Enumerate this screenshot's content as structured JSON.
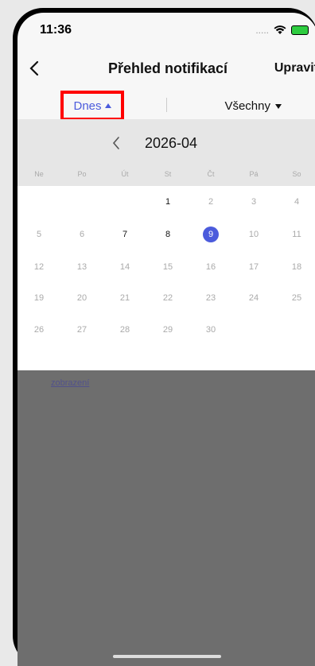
{
  "status": {
    "time": "11:36",
    "signal": "....."
  },
  "nav": {
    "title": "Přehled notifikací",
    "edit": "Upravit"
  },
  "filters": {
    "today": "Dnes",
    "all": "Všechny"
  },
  "calendar": {
    "month": "2026-04",
    "weekdays": [
      "Ne",
      "Po",
      "Út",
      "St",
      "Čt",
      "Pá",
      "So"
    ],
    "weeks": [
      [
        "",
        "",
        "",
        "1",
        "2",
        "3",
        "4"
      ],
      [
        "5",
        "6",
        "7",
        "8",
        "9",
        "10",
        "11"
      ],
      [
        "12",
        "13",
        "14",
        "15",
        "16",
        "17",
        "18"
      ],
      [
        "19",
        "20",
        "21",
        "22",
        "23",
        "24",
        "25"
      ],
      [
        "26",
        "27",
        "28",
        "29",
        "30",
        "",
        ""
      ]
    ],
    "selected": "9"
  },
  "background": {
    "link_text": "zobrazení"
  },
  "colors": {
    "accent": "#4b5bdc",
    "highlight": "#ff0000"
  }
}
